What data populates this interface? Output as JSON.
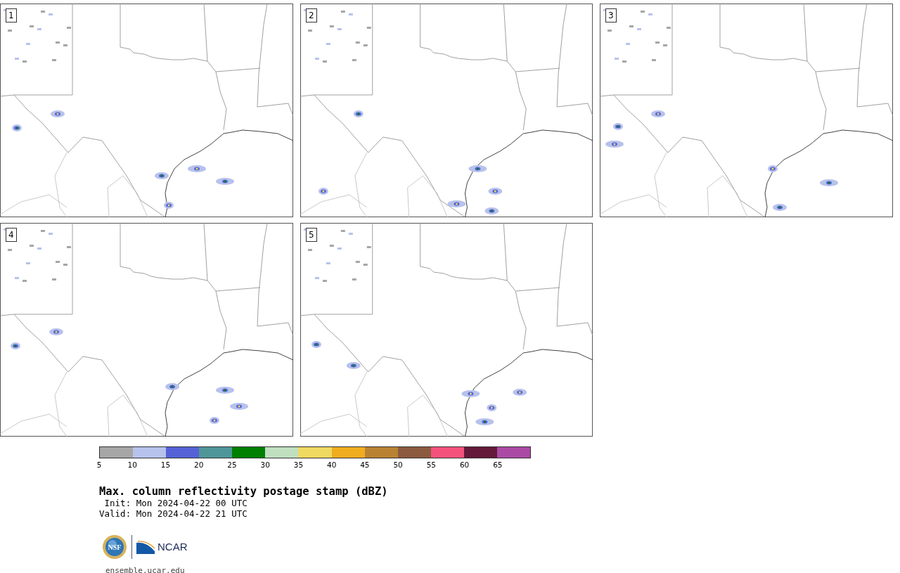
{
  "panels": [
    {
      "label": "1"
    },
    {
      "label": "2"
    },
    {
      "label": "3"
    },
    {
      "label": "4"
    },
    {
      "label": "5"
    }
  ],
  "colorbar": {
    "segments": [
      {
        "color": "#a6a6a6"
      },
      {
        "color": "#b7c2ec"
      },
      {
        "color": "#5462d6"
      },
      {
        "color": "#4f9699"
      },
      {
        "color": "#008000"
      },
      {
        "color": "#c0dfbf"
      },
      {
        "color": "#efd960"
      },
      {
        "color": "#efad1f"
      },
      {
        "color": "#b98233"
      },
      {
        "color": "#8b5a3f"
      },
      {
        "color": "#f4527c"
      },
      {
        "color": "#631939"
      },
      {
        "color": "#ab4aa4"
      }
    ],
    "ticks": [
      "5",
      "10",
      "15",
      "20",
      "25",
      "30",
      "35",
      "40",
      "45",
      "50",
      "55",
      "60",
      "65"
    ]
  },
  "title": "Max. column reflectivity postage stamp (dBZ)",
  "init": " Init: Mon 2024-04-22 00 UTC",
  "valid": "Valid: Mon 2024-04-22 21 UTC",
  "logos": {
    "nsf": "NSF",
    "ncar": "NCAR"
  },
  "url": "ensemble.ucar.edu"
}
